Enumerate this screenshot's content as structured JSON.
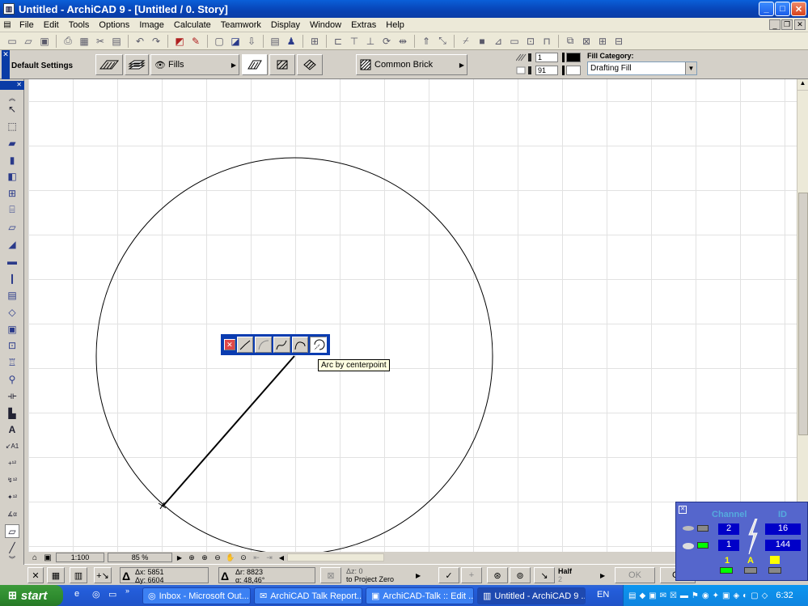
{
  "window": {
    "title": "Untitled - ArchiCAD 9 - [Untitled / 0. Story]",
    "min_label": "_",
    "max_label": "□",
    "close_label": "✕"
  },
  "menu": [
    "File",
    "Edit",
    "Tools",
    "Options",
    "Image",
    "Calculate",
    "Teamwork",
    "Display",
    "Window",
    "Extras",
    "Help"
  ],
  "infobox": {
    "settings_label": "Default Settings",
    "fills_label": "Fills",
    "fill_pattern_label": "Common Brick",
    "pen_1": "1",
    "pen_91": "91",
    "fill_category_label": "Fill Category:",
    "fill_category_value": "Drafting Fill"
  },
  "arc_palette": {
    "tooltip": "Arc by centerpoint"
  },
  "status": {
    "scale": "1:100",
    "zoom": "85 %"
  },
  "coords": {
    "dx": "Δx: 5851",
    "dy": "Δy: 6604",
    "dr": "Δr: 8823",
    "angle": "α: 48,46°",
    "dz": "Δz: 0",
    "to_project_zero": "to Project Zero",
    "half_label": "Half",
    "half_value": "2",
    "ok_label": "OK",
    "cancel_label": "Ca"
  },
  "teamwork_palette": {
    "channel_label": "Channel",
    "id_label": "ID",
    "channel_1": "2",
    "channel_2": "1",
    "id_1": "16",
    "id_2": "144",
    "bottom_labels": [
      "1",
      "A",
      ""
    ]
  },
  "taskbar": {
    "start_label": "start",
    "tasks": [
      "Inbox - Microsoft Out...",
      "ArchiCAD Talk Report...",
      "ArchiCAD-Talk :: Edit ...",
      "Untitled - ArchiCAD 9 ..."
    ],
    "language": "EN",
    "clock": "6:32"
  },
  "colors": {
    "titlebar": "#0842b4",
    "taskbar": "#245edb",
    "start_button": "#2e8b2e",
    "palette_bg": "#5566cc",
    "palette_accent": "#00ff00"
  }
}
